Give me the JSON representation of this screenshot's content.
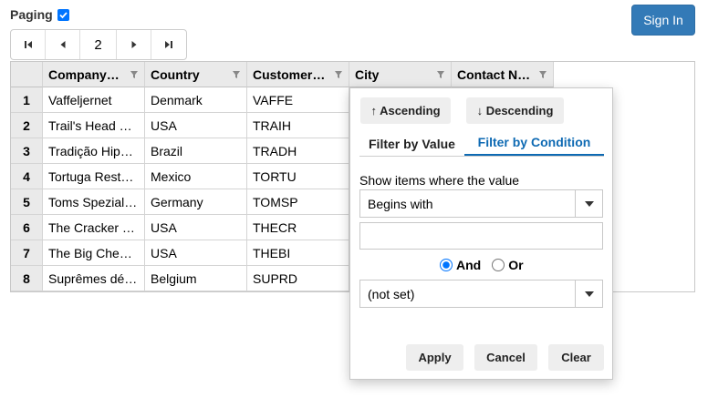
{
  "paging": {
    "label": "Paging",
    "checked": true
  },
  "signin": {
    "label": "Sign In"
  },
  "pager": {
    "current_page": "2"
  },
  "grid": {
    "columns": [
      "Company…",
      "Country",
      "Customer…",
      "City",
      "Contact N…"
    ],
    "rows": [
      {
        "num": "1",
        "company": "Vaffeljernet",
        "country": "Denmark",
        "customer": "VAFFE"
      },
      {
        "num": "2",
        "company": "Trail's Head …",
        "country": "USA",
        "customer": "TRAIH"
      },
      {
        "num": "3",
        "company": "Tradição Hip…",
        "country": "Brazil",
        "customer": "TRADH"
      },
      {
        "num": "4",
        "company": "Tortuga Rest…",
        "country": "Mexico",
        "customer": "TORTU"
      },
      {
        "num": "5",
        "company": "Toms Spezial…",
        "country": "Germany",
        "customer": "TOMSP"
      },
      {
        "num": "6",
        "company": "The Cracker …",
        "country": "USA",
        "customer": "THECR"
      },
      {
        "num": "7",
        "company": "The Big Che…",
        "country": "USA",
        "customer": "THEBI"
      },
      {
        "num": "8",
        "company": "Suprêmes dé…",
        "country": "Belgium",
        "customer": "SUPRD"
      }
    ]
  },
  "filter": {
    "sort_asc": "↑ Ascending",
    "sort_desc": "↓ Descending",
    "tab_value": "Filter by Value",
    "tab_condition": "Filter by Condition",
    "show_items": "Show items where the value",
    "condition1": "Begins with",
    "value1": "",
    "and_label": "And",
    "or_label": "Or",
    "condition2": "(not set)",
    "apply": "Apply",
    "cancel": "Cancel",
    "clear": "Clear"
  },
  "colors": {
    "accent": "#0e6ab3",
    "signin": "#337ab7",
    "checkbox": "#0075ff"
  }
}
